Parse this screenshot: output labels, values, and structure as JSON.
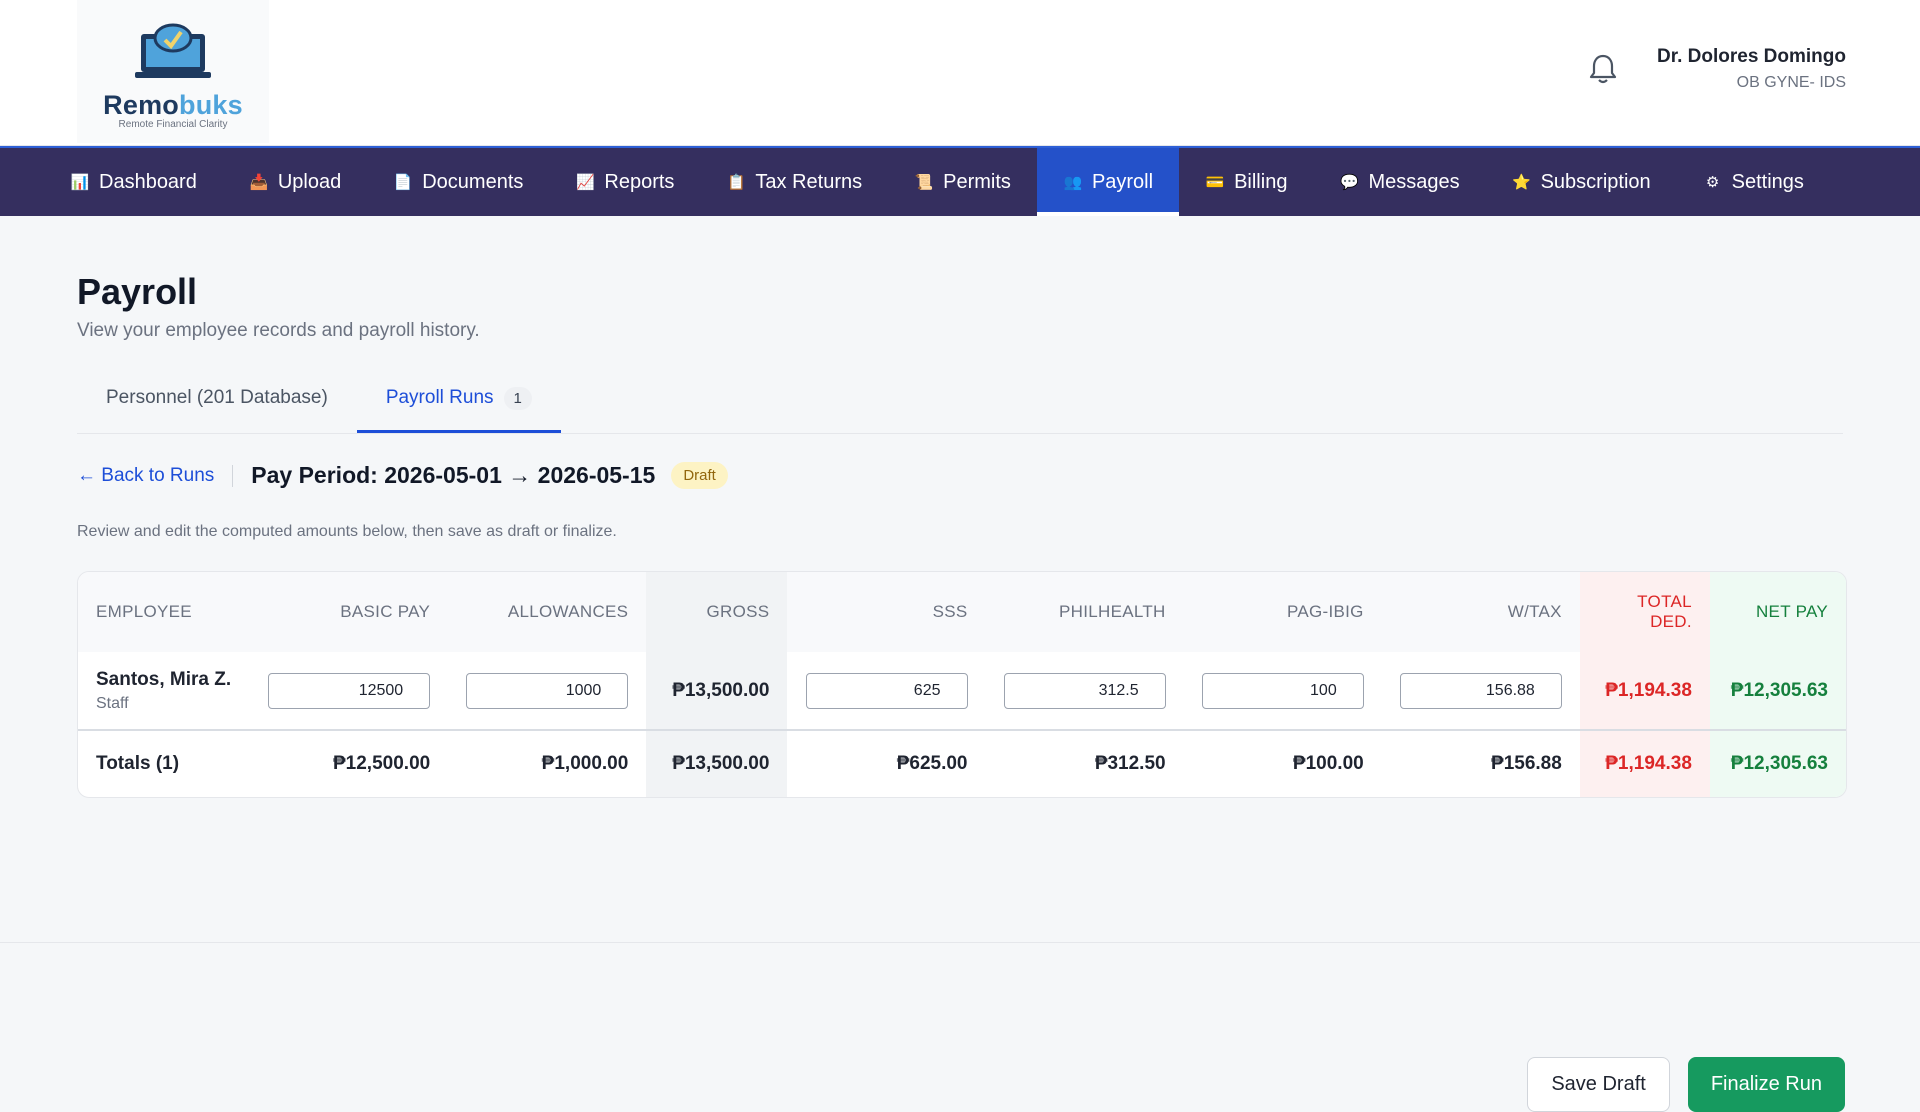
{
  "brand": {
    "name_a": "Remo",
    "name_b": "buks",
    "tagline": "Remote Financial Clarity"
  },
  "user": {
    "name": "Dr. Dolores Domingo",
    "role": "OB GYNE- IDS"
  },
  "nav": [
    {
      "label": "Dashboard",
      "icon": "bar-chart-icon"
    },
    {
      "label": "Upload",
      "icon": "inbox-tray-icon"
    },
    {
      "label": "Documents",
      "icon": "document-icon"
    },
    {
      "label": "Reports",
      "icon": "trend-chart-icon"
    },
    {
      "label": "Tax Returns",
      "icon": "clipboard-icon"
    },
    {
      "label": "Permits",
      "icon": "scroll-icon"
    },
    {
      "label": "Payroll",
      "icon": "people-icon",
      "active": true
    },
    {
      "label": "Billing",
      "icon": "credit-card-icon"
    },
    {
      "label": "Messages",
      "icon": "speech-bubble-icon"
    },
    {
      "label": "Subscription",
      "icon": "star-icon"
    },
    {
      "label": "Settings",
      "icon": "gear-icon"
    }
  ],
  "page": {
    "title": "Payroll",
    "subtitle": "View your employee records and payroll history."
  },
  "tabs": [
    {
      "label": "Personnel (201 Database)"
    },
    {
      "label": "Payroll Runs",
      "count": "1",
      "active": true
    }
  ],
  "run": {
    "back_label": "← Back to Runs",
    "period": "Pay Period: 2026-05-01 → 2026-05-15",
    "status": "Draft",
    "hint": "Review and edit the computed amounts below, then save as draft or finalize."
  },
  "table": {
    "headers": {
      "employee": "EMPLOYEE",
      "basic_pay": "BASIC PAY",
      "allowances": "ALLOWANCES",
      "gross": "GROSS",
      "sss": "SSS",
      "philhealth": "PHILHEALTH",
      "pagibig": "PAG-IBIG",
      "wtax": "W/TAX",
      "total_ded": "TOTAL DED.",
      "net_pay": "NET PAY"
    },
    "rows": [
      {
        "name": "Santos, Mira Z.",
        "role": "Staff",
        "basic_pay": "12500",
        "allowances": "1000",
        "gross": "₱13,500.00",
        "sss": "625",
        "philhealth": "312.5",
        "pagibig": "100",
        "wtax": "156.88",
        "total_ded": "₱1,194.38",
        "net_pay": "₱12,305.63"
      }
    ],
    "totals": {
      "label": "Totals (1)",
      "basic_pay": "₱12,500.00",
      "allowances": "₱1,000.00",
      "gross": "₱13,500.00",
      "sss": "₱625.00",
      "philhealth": "₱312.50",
      "pagibig": "₱100.00",
      "wtax": "₱156.88",
      "total_ded": "₱1,194.38",
      "net_pay": "₱12,305.63"
    }
  },
  "actions": {
    "save_draft": "Save Draft",
    "finalize": "Finalize Run"
  },
  "colors": {
    "nav_bg": "#352f5f",
    "nav_active": "#2451c9",
    "primary_green": "#169a5f",
    "link_blue": "#1d4ed8",
    "deduction_red": "#dc2626"
  }
}
